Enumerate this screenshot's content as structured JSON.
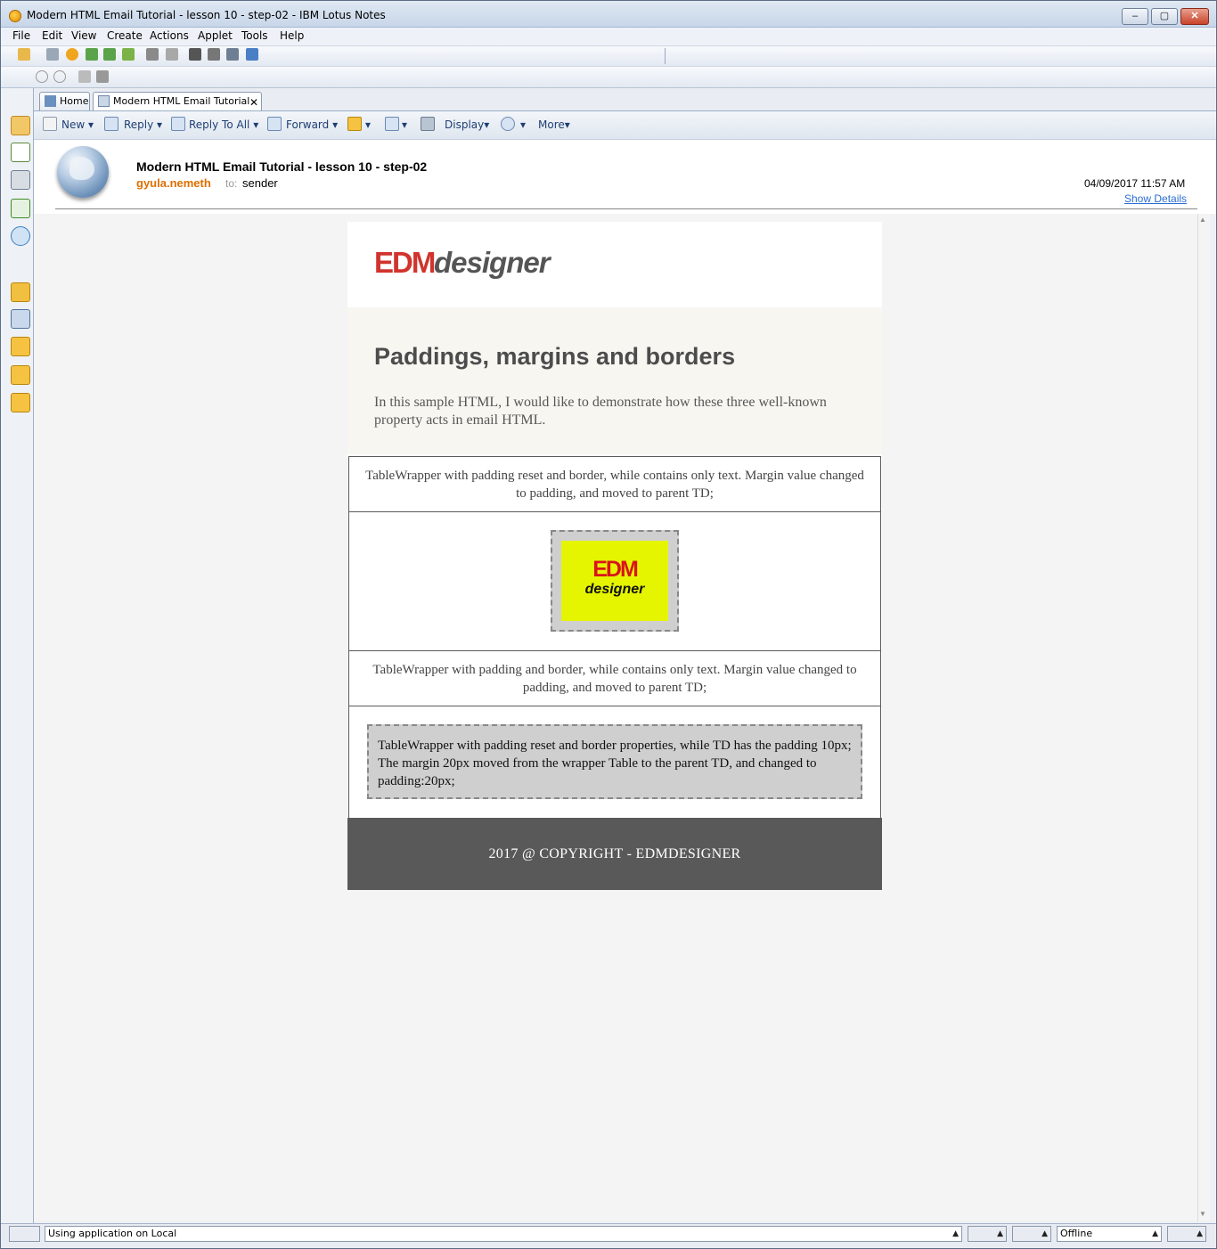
{
  "window": {
    "title": "Modern HTML Email Tutorial - lesson 10 - step-02 - IBM Lotus Notes",
    "min": "–",
    "max": "▢",
    "close": "✕"
  },
  "menu": [
    "File",
    "Edit",
    "View",
    "Create",
    "Actions",
    "Applet",
    "Tools",
    "Help"
  ],
  "tabs": {
    "home": "Home",
    "doc": "Modern HTML Email Tutorial -...",
    "close": "✕"
  },
  "actions": {
    "new": "New",
    "reply": "Reply",
    "reply_all": "Reply To All",
    "forward": "Forward",
    "display": "Display",
    "more": "More"
  },
  "message": {
    "subject": "Modern HTML Email Tutorial - lesson 10 - step-02",
    "from": "gyula.nemeth",
    "to_label": "to:",
    "to": "sender",
    "date": "04/09/2017 11:57 AM",
    "show_details": "Show Details"
  },
  "email": {
    "logo_edm": "EDM",
    "logo_designer": "designer",
    "hero_title": "Paddings, margins and borders",
    "hero_text": "In this sample HTML, I would like to demonstrate how these three well-known property acts in email HTML.",
    "row1": "TableWrapper with padding reset and border, while contains only text. Margin value changed to padding, and moved to parent TD;",
    "img_edm": "EDM",
    "img_designer": "designer",
    "row3": "TableWrapper with padding and border, while contains only text. Margin value changed to padding, and moved to parent TD;",
    "row4": "TableWrapper with padding reset and border properties, while TD has the padding 10px; The margin 20px moved from the wrapper Table to the parent TD, and changed to padding:20px;",
    "footer": "2017 @ COPYRIGHT - EDMDESIGNER"
  },
  "status": {
    "text": "Using application on Local",
    "location": "Offline"
  },
  "colors": {
    "accent": "#d0342c",
    "from": "#e06f00",
    "link": "#2a6ed1",
    "footer_bg": "#595959",
    "image_bg": "#e5f500"
  }
}
